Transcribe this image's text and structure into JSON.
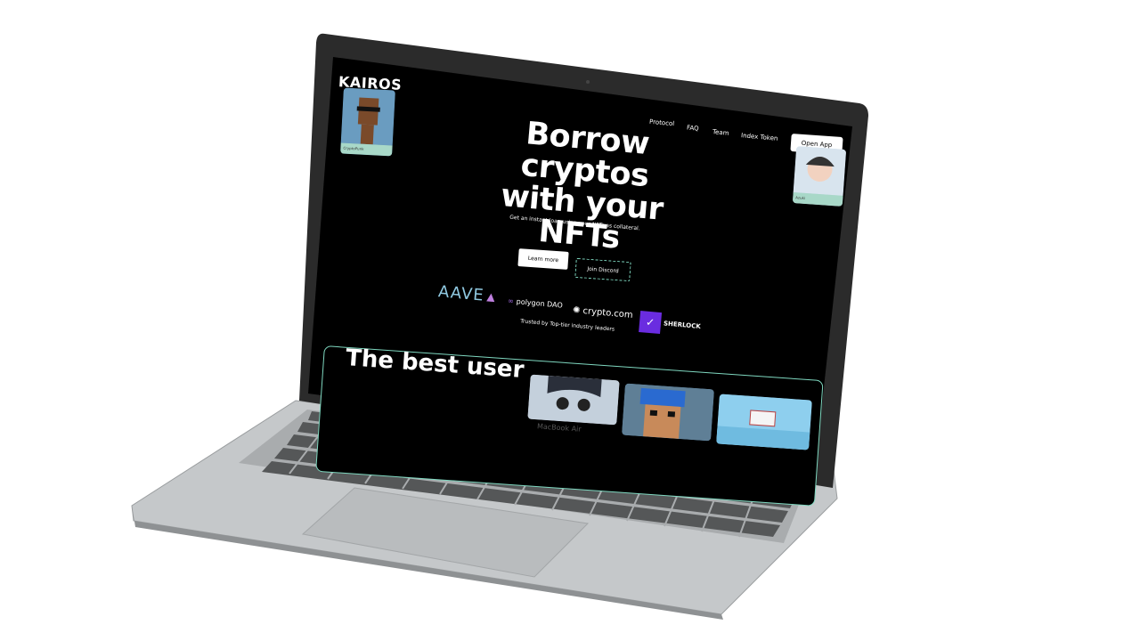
{
  "app": {
    "logo": "KAIROS"
  },
  "nav": {
    "links": [
      "Protocol",
      "FAQ",
      "Team",
      "Index Token"
    ],
    "open_app": "Open App"
  },
  "hero": {
    "title": "Borrow cryptos with your NFTs",
    "subtitle": "Get an instant loan using your NFTs as collateral.",
    "learn_more": "Learn more",
    "join_discord": "Join Discord"
  },
  "partners": {
    "items": [
      "AAVE",
      "polygon DAO",
      "crypto.com",
      "SHERLOCK"
    ],
    "caption": "Trusted by Top-tier industry leaders"
  },
  "feature": {
    "title": "The best user"
  },
  "nft_cards": {
    "left_label": "CryptoPunk",
    "right_label": "Azuki"
  },
  "device": {
    "label": "MacBook Air"
  },
  "colors": {
    "accent": "#7fd8c0",
    "screen_bg": "#000000",
    "body": "#b7babc"
  }
}
